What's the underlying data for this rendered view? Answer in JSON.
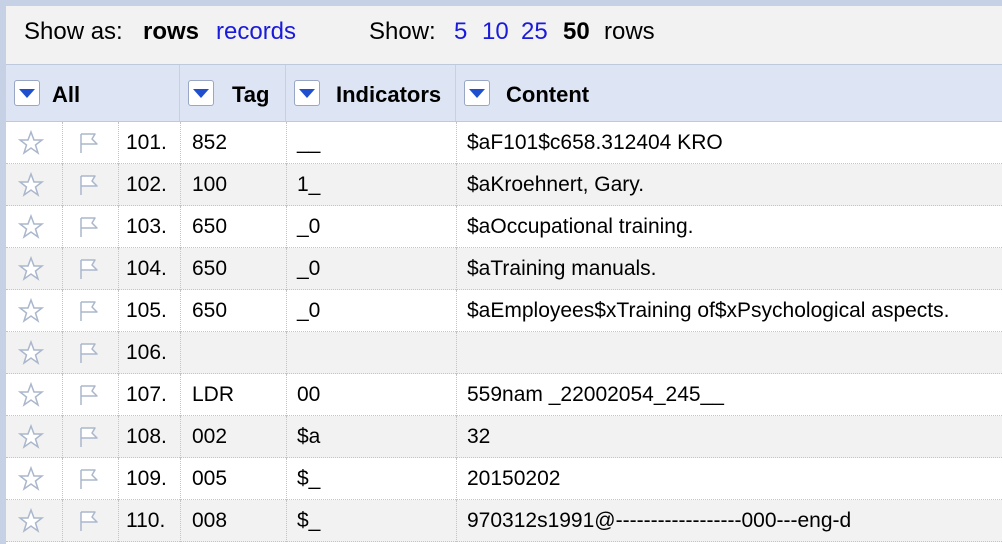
{
  "toolbar": {
    "show_as_label": "Show as:",
    "mode_rows": "rows",
    "mode_records": "records",
    "show_label": "Show:",
    "page_sizes": [
      "5",
      "10",
      "25",
      "50"
    ],
    "rows_suffix": "rows"
  },
  "columns": {
    "all": "All",
    "tag": "Tag",
    "indicators": "Indicators",
    "content": "Content"
  },
  "rows": [
    {
      "index": "101.",
      "tag": "852",
      "indicators": "__",
      "content": "$aF101$c658.312404 KRO"
    },
    {
      "index": "102.",
      "tag": "100",
      "indicators": "1_",
      "content": "$aKroehnert, Gary."
    },
    {
      "index": "103.",
      "tag": "650",
      "indicators": "_0",
      "content": "$aOccupational training."
    },
    {
      "index": "104.",
      "tag": "650",
      "indicators": "_0",
      "content": "$aTraining manuals."
    },
    {
      "index": "105.",
      "tag": "650",
      "indicators": "_0",
      "content": "$aEmployees$xTraining of$xPsychological aspects."
    },
    {
      "index": "106.",
      "tag": "",
      "indicators": "",
      "content": ""
    },
    {
      "index": "107.",
      "tag": "LDR",
      "indicators": "00",
      "content": "559nam _22002054_245__"
    },
    {
      "index": "108.",
      "tag": "002",
      "indicators": "$a",
      "content": "32"
    },
    {
      "index": "109.",
      "tag": "005",
      "indicators": "$_",
      "content": "20150202"
    },
    {
      "index": "110.",
      "tag": "008",
      "indicators": "$_",
      "content": "970312s1991@------------------000---eng-d"
    }
  ],
  "icons": {
    "star": "star-icon",
    "flag": "flag-icon",
    "dropdown": "chevron-down-icon"
  },
  "colors": {
    "link": "#1a1adb",
    "header_bg": "#dde4f3",
    "dropdown_arrow": "#1f4fcf"
  }
}
